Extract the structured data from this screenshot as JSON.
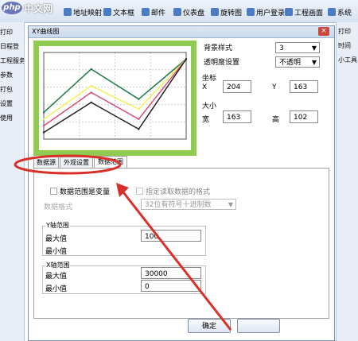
{
  "app": {
    "logo_symbol": "php",
    "logo_text": "中文网",
    "toolbar": [
      "地址映射",
      "文本框",
      "邮件",
      "仪表盘",
      "旋转图",
      "用户登录",
      "工程画面",
      "系统"
    ],
    "left_panel": [
      "打印",
      "日程登",
      "工程服务",
      "参数",
      "打包",
      "设置",
      "使用"
    ],
    "right_panel": [
      "打印",
      "时间",
      "小工具"
    ]
  },
  "dialog": {
    "title": "XY曲线图",
    "close_glyph": "×",
    "background_style_label": "背景样式",
    "background_style_value": "3",
    "transparency_label": "透明度设置",
    "transparency_value": "不透明",
    "coord_label": "坐标",
    "x_label": "X",
    "x_value": "204",
    "y_label": "Y",
    "y_value": "163",
    "size_label": "大小",
    "width_label": "宽",
    "width_value": "163",
    "height_label": "高",
    "height_value": "102",
    "tabs": [
      "数据源",
      "外观设置",
      "数据范围"
    ],
    "data_range_checkbox_label": "数据范围是变量",
    "specify_format_checkbox_label": "指定读取数据的格式",
    "data_format_label": "数据格式",
    "data_format_value": "32位有符号十进制数",
    "y_range_title": "Y轴范围",
    "y_max_label": "最大值",
    "y_max_value": "100",
    "y_min_label": "最小值",
    "y_min_value": "",
    "x_range_title": "X轴范围",
    "x_max_label": "最大值",
    "x_max_value": "30000",
    "x_min_label": "最小值",
    "x_min_value": "0",
    "ok_button": "确定"
  },
  "colors": {
    "chart_background": "#8fcb4e",
    "annotation_red": "#d9302a",
    "series": [
      "#1f7a4a",
      "#f2f25a",
      "#d94f7a",
      "#222222"
    ]
  },
  "chart_data": {
    "type": "line",
    "x": [
      0,
      1,
      2,
      3
    ],
    "series": [
      {
        "values": [
          40,
          105,
          60,
          120
        ]
      },
      {
        "values": [
          30,
          80,
          45,
          120
        ]
      },
      {
        "values": [
          20,
          70,
          30,
          120
        ]
      },
      {
        "values": [
          10,
          55,
          15,
          120
        ]
      }
    ],
    "ylim": [
      0,
      130
    ],
    "grid": true
  }
}
